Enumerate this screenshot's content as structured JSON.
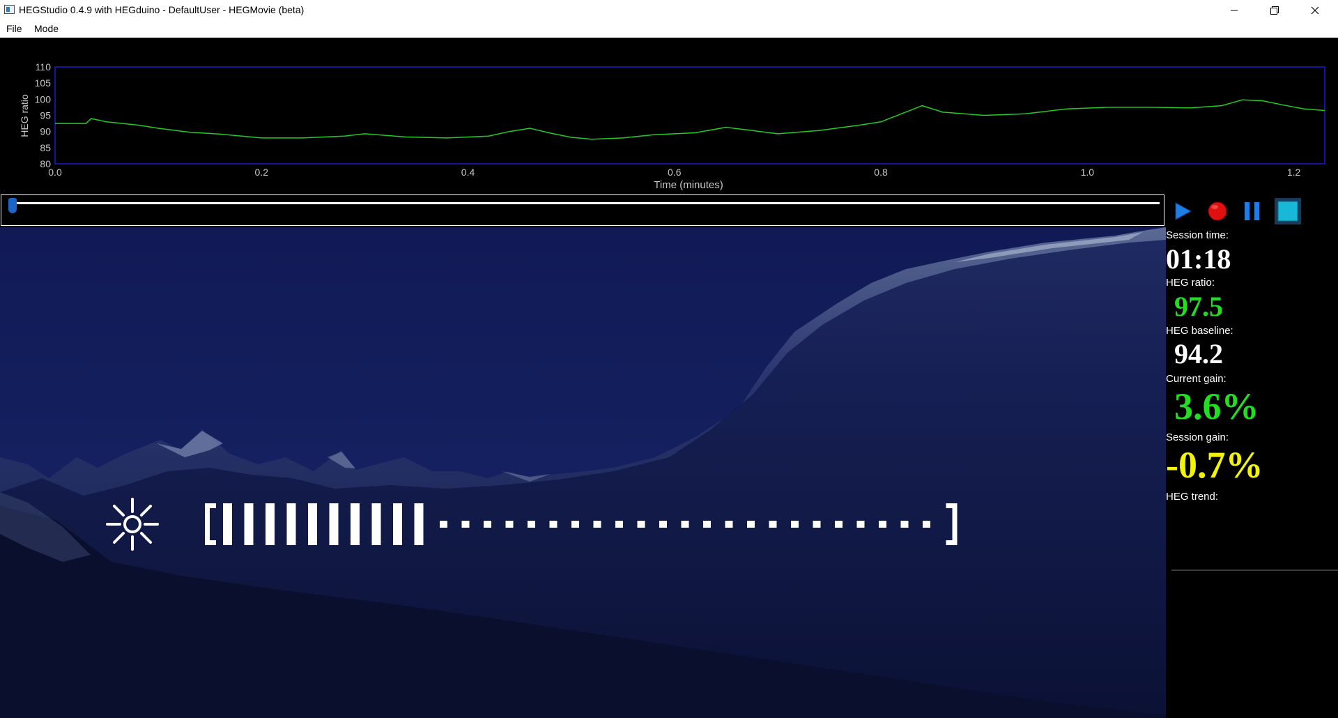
{
  "window": {
    "title": "HEGStudio 0.4.9 with HEGduino - DefaultUser - HEGMovie (beta)",
    "controls": [
      "minimize-icon",
      "restore-icon",
      "close-icon"
    ]
  },
  "menu": {
    "file": "File",
    "mode": "Mode"
  },
  "chart_data": {
    "type": "line",
    "title": "",
    "xlabel": "Time (minutes)",
    "ylabel": "HEG ratio",
    "xlim": [
      0,
      1.23
    ],
    "ylim": [
      80,
      110
    ],
    "xticks": [
      0.0,
      0.2,
      0.4,
      0.6,
      0.8,
      1.0,
      1.2
    ],
    "xtick_labels": [
      "0.0",
      "0.2",
      "0.4",
      "0.6",
      "0.8",
      "1.0",
      "1.2"
    ],
    "yticks": [
      80,
      85,
      90,
      95,
      100,
      105,
      110
    ],
    "ytick_labels": [
      "80",
      "85",
      "90",
      "95",
      "100",
      "105",
      "110"
    ],
    "grid": false,
    "colors": {
      "line": "#22cc22",
      "frame": "#1a1ad0",
      "background": "#000000",
      "text": "#c8c8c8"
    },
    "series": [
      {
        "x": [
          0.0,
          0.03,
          0.035,
          0.05,
          0.08,
          0.1,
          0.13,
          0.16,
          0.2,
          0.24,
          0.28,
          0.3,
          0.34,
          0.38,
          0.42,
          0.44,
          0.46,
          0.48,
          0.5,
          0.52,
          0.55,
          0.58,
          0.62,
          0.65,
          0.67,
          0.7,
          0.74,
          0.78,
          0.8,
          0.82,
          0.84,
          0.86,
          0.9,
          0.94,
          0.98,
          1.02,
          1.06,
          1.1,
          1.13,
          1.15,
          1.17,
          1.19,
          1.21,
          1.23
        ],
        "y": [
          92.5,
          92.5,
          94.0,
          93.0,
          92.0,
          91.0,
          89.8,
          89.2,
          88.0,
          88.0,
          88.6,
          89.3,
          88.3,
          88.0,
          88.6,
          90.0,
          91.0,
          89.5,
          88.2,
          87.6,
          88.0,
          89.0,
          89.6,
          91.3,
          90.5,
          89.3,
          90.3,
          92.0,
          93.0,
          95.5,
          98.0,
          96.0,
          95.0,
          95.5,
          97.0,
          97.5,
          97.5,
          97.3,
          98.0,
          99.8,
          99.5,
          98.2,
          97.0,
          96.5
        ]
      }
    ]
  },
  "playback": {
    "position": 0.0,
    "buttons": {
      "play": "play-icon",
      "record": "record-icon",
      "pause": "pause-icon",
      "stop": "stop-icon"
    },
    "colors": {
      "play": "#1f7de3",
      "record": "#e01010",
      "pause": "#1f7de3",
      "stop": "#18b8d8"
    }
  },
  "stats": {
    "session_time_label": "Session time:",
    "session_time": "01:18",
    "heg_ratio_label": "HEG ratio:",
    "heg_ratio": "97.5",
    "heg_baseline_label": "HEG baseline:",
    "heg_baseline": "94.2",
    "current_gain_label": "Current gain:",
    "current_gain": "3.6%",
    "session_gain_label": "Session gain:",
    "session_gain": "-0.7%",
    "heg_trend_label": "HEG trend:",
    "colors": {
      "positive": "#22dd22",
      "neutral": "#ffffff",
      "warning": "#f2f20a"
    }
  },
  "feedback": {
    "icon": "brightness-icon",
    "filled_segments": 11,
    "total_segments": 34
  }
}
